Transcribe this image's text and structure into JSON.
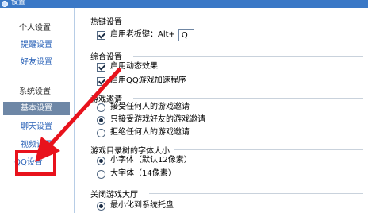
{
  "window": {
    "title": "设置"
  },
  "sidebar": {
    "groups": [
      {
        "label": "个人设置",
        "items": [
          "提醒设置",
          "好友设置"
        ]
      },
      {
        "label": "系统设置",
        "items": [
          "基本设置",
          "聊天设置",
          "视频设置",
          "QQ设置"
        ]
      }
    ],
    "active_item": "基本设置"
  },
  "main": {
    "hotkey": {
      "title": "热键设置",
      "boss_key_label": "启用老板键：Alt+",
      "boss_key_checked": true,
      "boss_key_value": "Q"
    },
    "general": {
      "title": "综合设置",
      "items": [
        {
          "label": "启用动态效果",
          "checked": true
        },
        {
          "label": "启用QQ游戏加速程序",
          "checked": true
        }
      ]
    },
    "invites": {
      "title": "游戏邀请",
      "options": [
        {
          "label": "接受任何人的游戏邀请",
          "selected": false
        },
        {
          "label": "只接受游戏好友的游戏邀请",
          "selected": true
        },
        {
          "label": "拒绝任何人的游戏邀请",
          "selected": false
        }
      ]
    },
    "font_size": {
      "title": "游戏目录树的字体大小",
      "options": [
        {
          "label": "小字体（默认12像素）",
          "selected": true
        },
        {
          "label": "大字体（14像素）",
          "selected": false
        }
      ]
    },
    "close_hall": {
      "title": "关闭游戏大厅",
      "options": [
        {
          "label": "最小化到系统托盘",
          "selected": true
        }
      ]
    }
  },
  "annotation": {
    "color": "#e8121c"
  },
  "colors": {
    "title_bar": "#3a78c6",
    "active_item_bg": "#6e87a6",
    "link_text": "#2b63b8"
  }
}
